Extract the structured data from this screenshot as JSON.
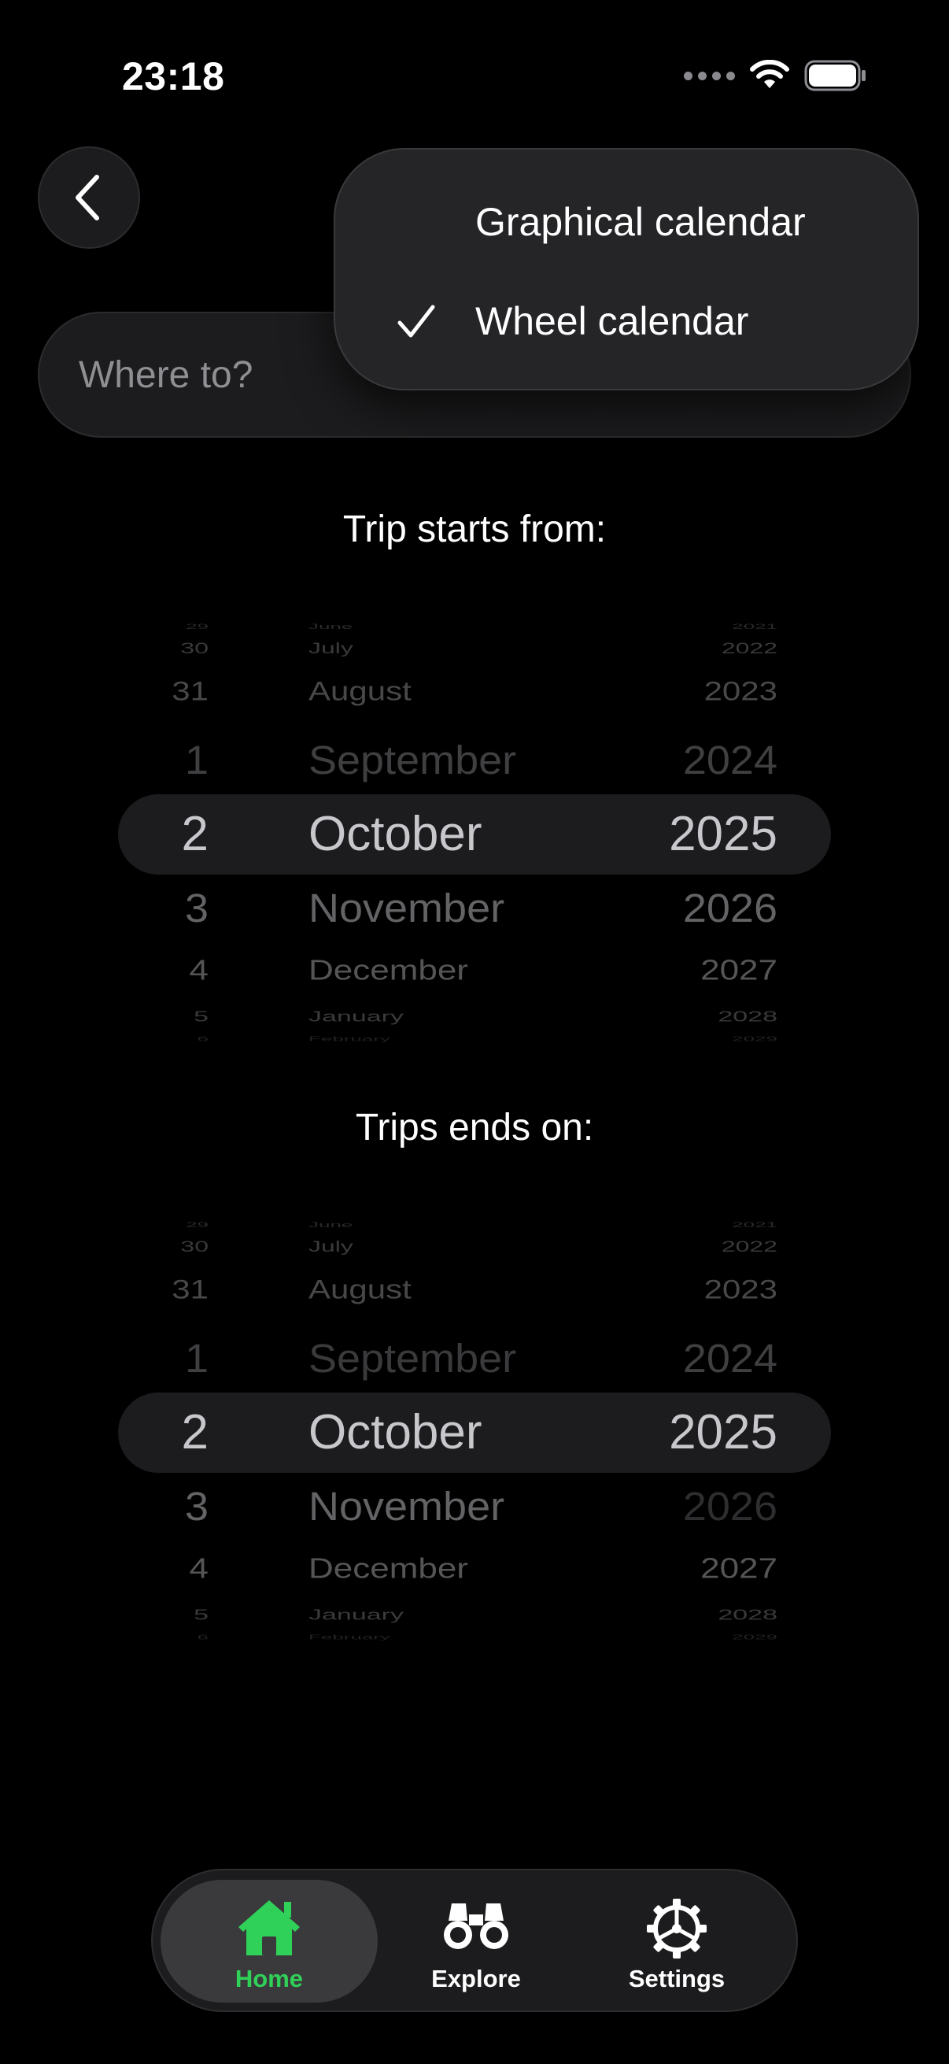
{
  "status_bar": {
    "time": "23:18"
  },
  "search": {
    "placeholder": "Where to?"
  },
  "calendar_menu": {
    "items": [
      {
        "label": "Graphical calendar",
        "checked": false
      },
      {
        "label": "Wheel calendar",
        "checked": true
      }
    ]
  },
  "start_picker": {
    "title": "Trip starts from:",
    "days": [
      "29",
      "30",
      "31",
      "1",
      "2",
      "3",
      "4",
      "5",
      "6"
    ],
    "months": [
      "June",
      "July",
      "August",
      "September",
      "October",
      "November",
      "December",
      "January",
      "February"
    ],
    "years": [
      "2021",
      "2022",
      "2023",
      "2024",
      "2025",
      "2026",
      "2027",
      "2028",
      "2029"
    ],
    "selected": {
      "day": "2",
      "month": "October",
      "year": "2025"
    }
  },
  "end_picker": {
    "title": "Trips ends on:",
    "days": [
      "29",
      "30",
      "31",
      "1",
      "2",
      "3",
      "4",
      "5",
      "6"
    ],
    "months": [
      "June",
      "July",
      "August",
      "September",
      "October",
      "November",
      "December",
      "January",
      "February"
    ],
    "years": [
      "2021",
      "2022",
      "2023",
      "2024",
      "2025",
      "2026",
      "2027",
      "2028",
      "2029"
    ],
    "selected": {
      "day": "2",
      "month": "October",
      "year": "2025"
    }
  },
  "tab_bar": {
    "tabs": [
      {
        "label": "Home",
        "icon": "house-icon",
        "active": true
      },
      {
        "label": "Explore",
        "icon": "binoculars-icon",
        "active": false
      },
      {
        "label": "Settings",
        "icon": "gear-icon",
        "active": false
      }
    ]
  },
  "colors": {
    "accent": "#30d158",
    "background": "#000000",
    "surface": "#1c1c1e"
  }
}
